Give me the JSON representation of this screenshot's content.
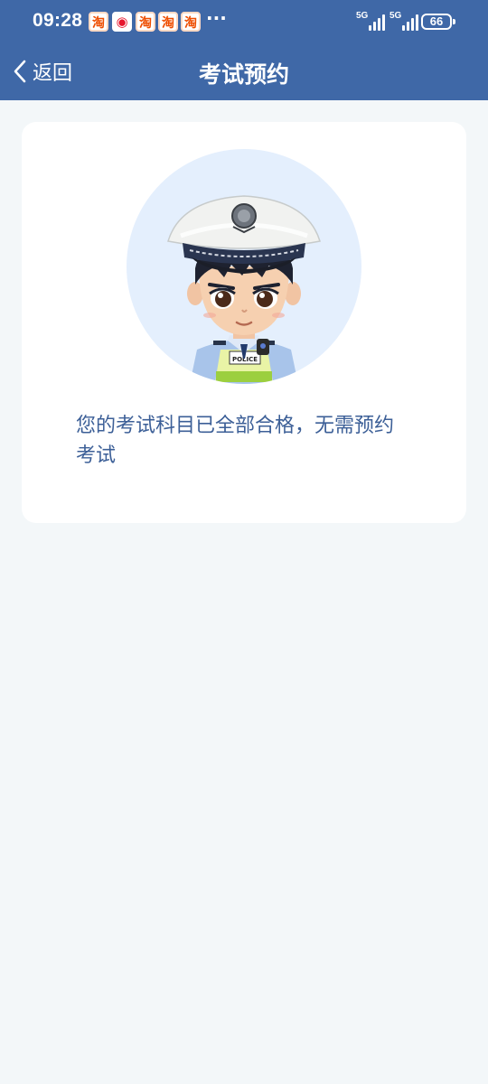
{
  "status_bar": {
    "time": "09:28",
    "notification_icons": [
      "taobao-icon",
      "weibo-icon",
      "taobao-icon",
      "taobao-icon",
      "taobao-icon"
    ],
    "more_indicator": "···",
    "network_1": "5G",
    "network_2": "5G",
    "battery_level": "66"
  },
  "nav": {
    "back_label": "返回",
    "title": "考试预约"
  },
  "card": {
    "avatar_icon": "police-officer-avatar",
    "badge_text": "POLICE",
    "message": "您的考试科目已全部合格，无需预约考试"
  },
  "colors": {
    "header_bg": "#3f68a7",
    "page_bg": "#f3f7f9",
    "card_bg": "#ffffff",
    "message_text": "#3c5f97",
    "avatar_bg": "#e4effd"
  }
}
